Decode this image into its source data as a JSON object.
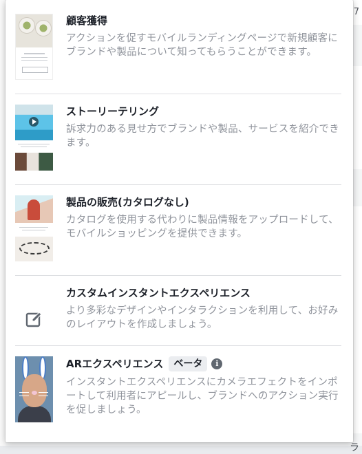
{
  "background": {
    "glyph_top": "7",
    "glyph_side": "ラ"
  },
  "menu": {
    "items": [
      {
        "title": "顧客獲得",
        "description": "アクションを促すモバイルランディングページで新規顧客にブランドや製品について知ってもらうことができます。",
        "thumbnail": "lead-generation-thumbnail"
      },
      {
        "title": "ストーリーテリング",
        "description": "訴求力のある見せ方でブランドや製品、サービスを紹介できます。",
        "thumbnail": "storytelling-thumbnail"
      },
      {
        "title": "製品の販売(カタログなし)",
        "description": "カタログを使用する代わりに製品情報をアップロードして、モバイルショッピングを提供できます。",
        "thumbnail": "product-sales-thumbnail"
      },
      {
        "title": "カスタムインスタントエクスペリエンス",
        "description": "より多彩なデザインやインタラクションを利用して、お好みのレイアウトを作成しましょう。",
        "icon": "edit-icon"
      },
      {
        "title": "ARエクスペリエンス",
        "badge": "ベータ",
        "info_icon": "info-icon",
        "description": "インスタントエクスペリエンスにカメラエフェクトをインポートして利用者にアピールし、ブランドへのアクション実行を促しましょう。",
        "thumbnail": "ar-experience-thumbnail"
      }
    ]
  },
  "colors": {
    "title": "#1d2129",
    "description": "#90949c",
    "divider": "#dddfe2",
    "icon": "#606770"
  }
}
